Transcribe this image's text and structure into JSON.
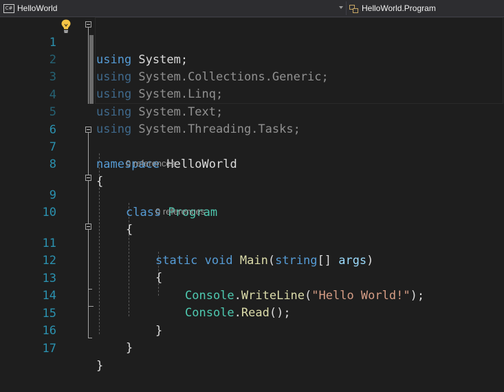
{
  "navbar": {
    "project_icon_label": "C#",
    "project_name": "HelloWorld",
    "member_name": "HelloWorld.Program"
  },
  "editor": {
    "lines": [
      {
        "num": "1"
      },
      {
        "num": "2"
      },
      {
        "num": "3"
      },
      {
        "num": "4"
      },
      {
        "num": "5"
      },
      {
        "num": "6"
      },
      {
        "num": "7"
      },
      {
        "num": "8"
      },
      {
        "num": "9"
      },
      {
        "num": "10"
      },
      {
        "num": "11"
      },
      {
        "num": "12"
      },
      {
        "num": "13"
      },
      {
        "num": "14"
      },
      {
        "num": "15"
      },
      {
        "num": "16"
      },
      {
        "num": "17"
      }
    ],
    "code": {
      "l1_kw": "using",
      "l1_rest": " System;",
      "l2_kw": "using",
      "l2_rest": " System.Collections.Generic;",
      "l3_kw": "using",
      "l3_rest": " System.Linq;",
      "l4_kw": "using",
      "l4_rest": " System.Text;",
      "l5_kw": "using",
      "l5_rest": " System.Threading.Tasks;",
      "l7_kw": "namespace",
      "l7_rest": " HelloWorld",
      "l8": "{",
      "l9_kw": "class",
      "l9_type": "Program",
      "l10": "{",
      "l11_kw1": "static",
      "l11_kw2": "void",
      "l11_method": "Main",
      "l11_open": "(",
      "l11_kw3": "string",
      "l11_arr": "[] ",
      "l11_param": "args",
      "l11_close": ")",
      "l12": "{",
      "l13_type": "Console",
      "l13_dot": ".",
      "l13_method": "WriteLine",
      "l13_open": "(",
      "l13_str": "\"Hello World!\"",
      "l13_close": ");",
      "l14_type": "Console",
      "l14_dot": ".",
      "l14_method": "Read",
      "l14_close": "();",
      "l15": "}",
      "l16": "}",
      "l17": "}"
    },
    "codelens": {
      "class_refs": "0 references",
      "method_refs": "0 references"
    }
  },
  "colors": {
    "background": "#1e1e1e",
    "line_number": "#2b91af",
    "keyword": "#569cd6",
    "type": "#4ec9b0",
    "method": "#dcdcaa",
    "string": "#d69d85",
    "parameter": "#9cdcfe",
    "lightbulb": "#f6c445"
  },
  "icons": [
    "csharp-project-icon",
    "dropdown-arrow-icon",
    "class-member-icon",
    "lightbulb-icon",
    "collapse-icon"
  ]
}
